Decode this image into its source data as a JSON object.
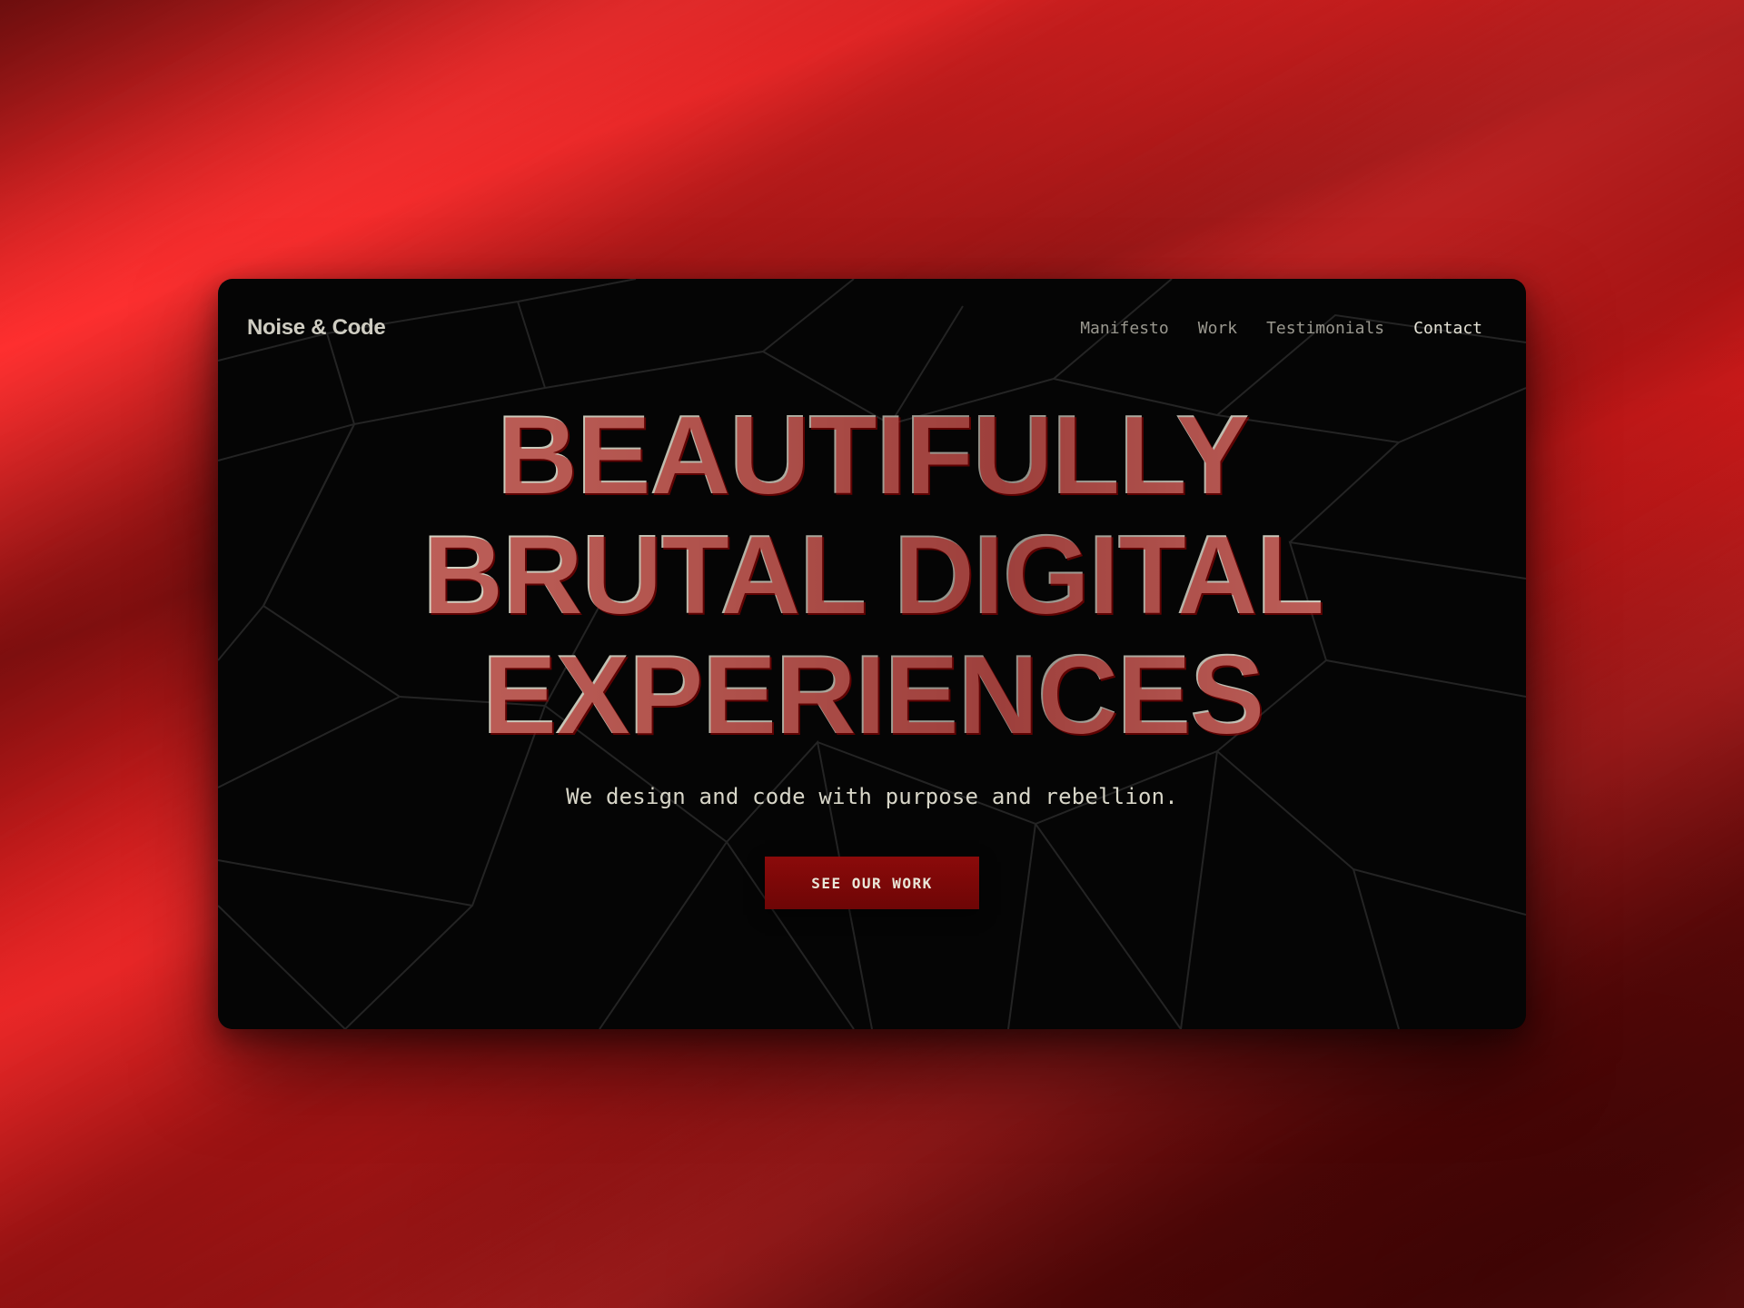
{
  "brand": {
    "name": "Noise & Code"
  },
  "nav": {
    "links": [
      {
        "label": "Manifesto",
        "active": false
      },
      {
        "label": "Work",
        "active": false
      },
      {
        "label": "Testimonials",
        "active": false
      },
      {
        "label": "Contact",
        "active": true
      }
    ]
  },
  "hero": {
    "headline_lines": [
      "BEAUTIFULLY",
      "BRUTAL DIGITAL",
      "EXPERIENCES"
    ],
    "subtitle": "We design and code with purpose and rebellion.",
    "cta_label": "SEE OUR WORK"
  },
  "colors": {
    "background_red": "#e21e1e",
    "panel_black": "#050505",
    "cta_red": "#8b0a0a",
    "text_cream": "#e4e2d6"
  }
}
